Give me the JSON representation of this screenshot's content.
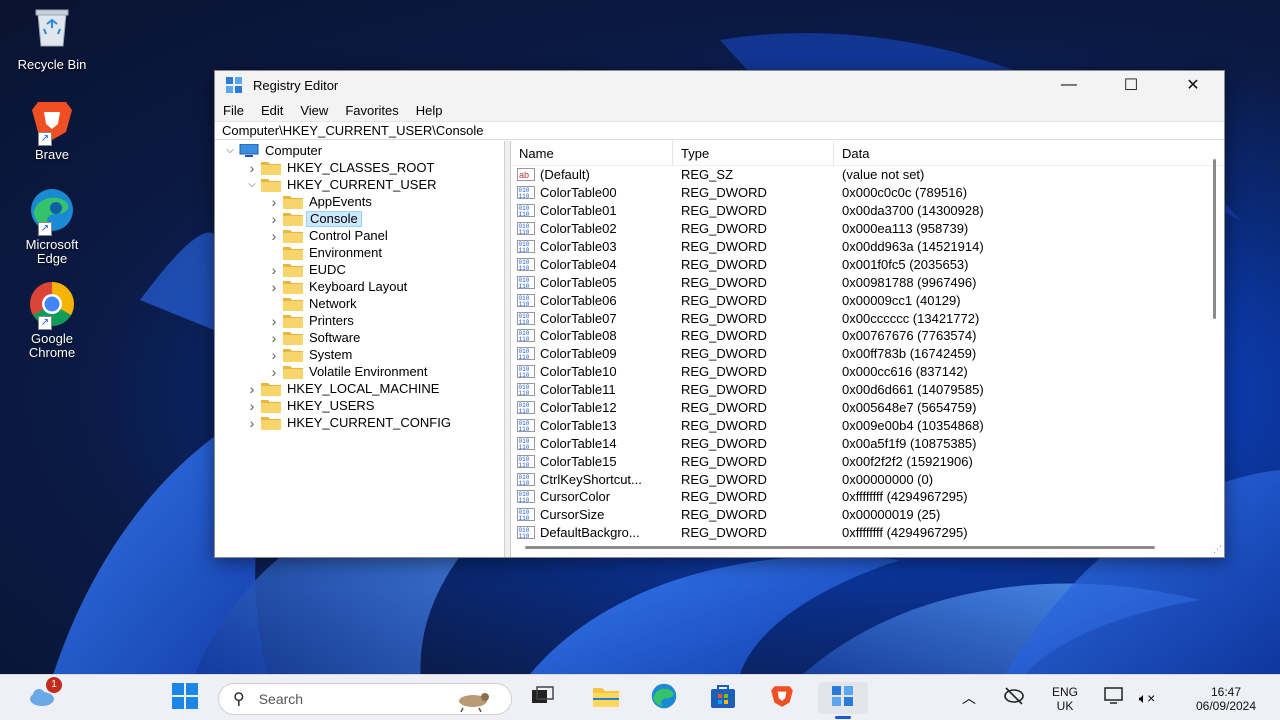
{
  "desktop": {
    "icons": [
      {
        "label": "Recycle Bin",
        "icon": "recycle-bin-icon"
      },
      {
        "label": "Brave",
        "icon": "brave-icon"
      },
      {
        "label": "Microsoft Edge",
        "icon": "edge-icon"
      },
      {
        "label": "Google Chrome",
        "icon": "chrome-icon"
      }
    ]
  },
  "window": {
    "title": "Registry Editor",
    "controls": {
      "minimize": "—",
      "maximize": "☐",
      "close": "✕"
    },
    "menu": [
      "File",
      "Edit",
      "View",
      "Favorites",
      "Help"
    ],
    "address": "Computer\\HKEY_CURRENT_USER\\Console"
  },
  "tree": {
    "root": "Computer",
    "items": [
      {
        "label": "HKEY_CLASSES_ROOT",
        "level": 1,
        "expanded": false
      },
      {
        "label": "HKEY_CURRENT_USER",
        "level": 1,
        "expanded": true
      },
      {
        "label": "AppEvents",
        "level": 2,
        "expanded": false
      },
      {
        "label": "Console",
        "level": 2,
        "expanded": false,
        "selected": true
      },
      {
        "label": "Control Panel",
        "level": 2,
        "expanded": false
      },
      {
        "label": "Environment",
        "level": 2,
        "leaf": true
      },
      {
        "label": "EUDC",
        "level": 2,
        "expanded": false
      },
      {
        "label": "Keyboard Layout",
        "level": 2,
        "expanded": false
      },
      {
        "label": "Network",
        "level": 2,
        "leaf": true
      },
      {
        "label": "Printers",
        "level": 2,
        "expanded": false
      },
      {
        "label": "Software",
        "level": 2,
        "expanded": false
      },
      {
        "label": "System",
        "level": 2,
        "expanded": false
      },
      {
        "label": "Volatile Environment",
        "level": 2,
        "expanded": false
      },
      {
        "label": "HKEY_LOCAL_MACHINE",
        "level": 1,
        "expanded": false
      },
      {
        "label": "HKEY_USERS",
        "level": 1,
        "expanded": false
      },
      {
        "label": "HKEY_CURRENT_CONFIG",
        "level": 1,
        "expanded": false
      }
    ]
  },
  "values": {
    "headers": {
      "name": "Name",
      "type": "Type",
      "data": "Data"
    },
    "rows": [
      {
        "name": "(Default)",
        "type": "REG_SZ",
        "data": "(value not set)",
        "kind": "string"
      },
      {
        "name": "ColorTable00",
        "type": "REG_DWORD",
        "data": "0x000c0c0c (789516)",
        "kind": "binary"
      },
      {
        "name": "ColorTable01",
        "type": "REG_DWORD",
        "data": "0x00da3700 (14300928)",
        "kind": "binary"
      },
      {
        "name": "ColorTable02",
        "type": "REG_DWORD",
        "data": "0x000ea113 (958739)",
        "kind": "binary"
      },
      {
        "name": "ColorTable03",
        "type": "REG_DWORD",
        "data": "0x00dd963a (14521914)",
        "kind": "binary"
      },
      {
        "name": "ColorTable04",
        "type": "REG_DWORD",
        "data": "0x001f0fc5 (2035653)",
        "kind": "binary"
      },
      {
        "name": "ColorTable05",
        "type": "REG_DWORD",
        "data": "0x00981788 (9967496)",
        "kind": "binary"
      },
      {
        "name": "ColorTable06",
        "type": "REG_DWORD",
        "data": "0x00009cc1 (40129)",
        "kind": "binary"
      },
      {
        "name": "ColorTable07",
        "type": "REG_DWORD",
        "data": "0x00cccccc (13421772)",
        "kind": "binary"
      },
      {
        "name": "ColorTable08",
        "type": "REG_DWORD",
        "data": "0x00767676 (7763574)",
        "kind": "binary"
      },
      {
        "name": "ColorTable09",
        "type": "REG_DWORD",
        "data": "0x00ff783b (16742459)",
        "kind": "binary"
      },
      {
        "name": "ColorTable10",
        "type": "REG_DWORD",
        "data": "0x000cc616 (837142)",
        "kind": "binary"
      },
      {
        "name": "ColorTable11",
        "type": "REG_DWORD",
        "data": "0x00d6d661 (14079585)",
        "kind": "binary"
      },
      {
        "name": "ColorTable12",
        "type": "REG_DWORD",
        "data": "0x005648e7 (5654759)",
        "kind": "binary"
      },
      {
        "name": "ColorTable13",
        "type": "REG_DWORD",
        "data": "0x009e00b4 (10354868)",
        "kind": "binary"
      },
      {
        "name": "ColorTable14",
        "type": "REG_DWORD",
        "data": "0x00a5f1f9 (10875385)",
        "kind": "binary"
      },
      {
        "name": "ColorTable15",
        "type": "REG_DWORD",
        "data": "0x00f2f2f2 (15921906)",
        "kind": "binary"
      },
      {
        "name": "CtrlKeyShortcut...",
        "type": "REG_DWORD",
        "data": "0x00000000 (0)",
        "kind": "binary"
      },
      {
        "name": "CursorColor",
        "type": "REG_DWORD",
        "data": "0xffffffff (4294967295)",
        "kind": "binary"
      },
      {
        "name": "CursorSize",
        "type": "REG_DWORD",
        "data": "0x00000019 (25)",
        "kind": "binary"
      },
      {
        "name": "DefaultBackgro...",
        "type": "REG_DWORD",
        "data": "0xffffffff (4294967295)",
        "kind": "binary"
      }
    ]
  },
  "taskbar": {
    "weather_badge": "1",
    "search_placeholder": "Search",
    "apps": [
      "start-icon",
      "task-view-icon",
      "file-explorer-icon",
      "edge-icon",
      "store-icon",
      "brave-icon",
      "registry-editor-icon"
    ],
    "tray": {
      "lang_line1": "ENG",
      "lang_line2": "UK",
      "time": "16:47",
      "date": "06/09/2024"
    }
  }
}
